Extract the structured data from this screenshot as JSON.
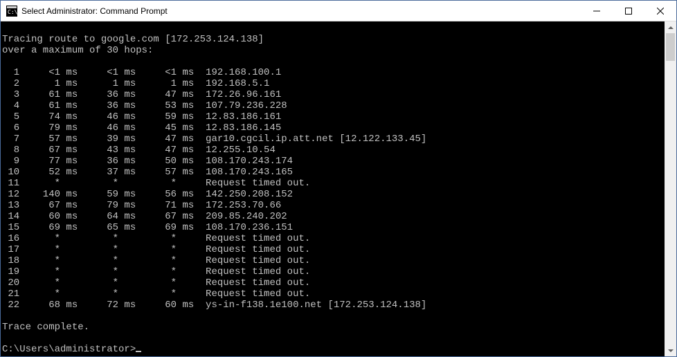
{
  "titlebar": {
    "title": "Select Administrator: Command Prompt"
  },
  "console": {
    "header1": "Tracing route to google.com [172.253.124.138]",
    "header2": "over a maximum of 30 hops:",
    "hops": [
      {
        "n": "1",
        "t1": "<1 ms",
        "t2": "<1 ms",
        "t3": "<1 ms",
        "host": "192.168.100.1"
      },
      {
        "n": "2",
        "t1": "1 ms",
        "t2": "1 ms",
        "t3": "1 ms",
        "host": "192.168.5.1"
      },
      {
        "n": "3",
        "t1": "61 ms",
        "t2": "36 ms",
        "t3": "47 ms",
        "host": "172.26.96.161"
      },
      {
        "n": "4",
        "t1": "61 ms",
        "t2": "36 ms",
        "t3": "53 ms",
        "host": "107.79.236.228"
      },
      {
        "n": "5",
        "t1": "74 ms",
        "t2": "46 ms",
        "t3": "59 ms",
        "host": "12.83.186.161"
      },
      {
        "n": "6",
        "t1": "79 ms",
        "t2": "46 ms",
        "t3": "45 ms",
        "host": "12.83.186.145"
      },
      {
        "n": "7",
        "t1": "57 ms",
        "t2": "39 ms",
        "t3": "47 ms",
        "host": "gar10.cgcil.ip.att.net [12.122.133.45]"
      },
      {
        "n": "8",
        "t1": "67 ms",
        "t2": "43 ms",
        "t3": "47 ms",
        "host": "12.255.10.54"
      },
      {
        "n": "9",
        "t1": "77 ms",
        "t2": "36 ms",
        "t3": "50 ms",
        "host": "108.170.243.174"
      },
      {
        "n": "10",
        "t1": "52 ms",
        "t2": "37 ms",
        "t3": "57 ms",
        "host": "108.170.243.165"
      },
      {
        "n": "11",
        "t1": "*",
        "t2": "*",
        "t3": "*",
        "host": "Request timed out."
      },
      {
        "n": "12",
        "t1": "140 ms",
        "t2": "59 ms",
        "t3": "56 ms",
        "host": "142.250.208.152"
      },
      {
        "n": "13",
        "t1": "67 ms",
        "t2": "79 ms",
        "t3": "71 ms",
        "host": "172.253.70.66"
      },
      {
        "n": "14",
        "t1": "60 ms",
        "t2": "64 ms",
        "t3": "67 ms",
        "host": "209.85.240.202"
      },
      {
        "n": "15",
        "t1": "69 ms",
        "t2": "65 ms",
        "t3": "69 ms",
        "host": "108.170.236.151"
      },
      {
        "n": "16",
        "t1": "*",
        "t2": "*",
        "t3": "*",
        "host": "Request timed out."
      },
      {
        "n": "17",
        "t1": "*",
        "t2": "*",
        "t3": "*",
        "host": "Request timed out."
      },
      {
        "n": "18",
        "t1": "*",
        "t2": "*",
        "t3": "*",
        "host": "Request timed out."
      },
      {
        "n": "19",
        "t1": "*",
        "t2": "*",
        "t3": "*",
        "host": "Request timed out."
      },
      {
        "n": "20",
        "t1": "*",
        "t2": "*",
        "t3": "*",
        "host": "Request timed out."
      },
      {
        "n": "21",
        "t1": "*",
        "t2": "*",
        "t3": "*",
        "host": "Request timed out."
      },
      {
        "n": "22",
        "t1": "68 ms",
        "t2": "72 ms",
        "t3": "60 ms",
        "host": "ys-in-f138.1e100.net [172.253.124.138]"
      }
    ],
    "complete": "Trace complete.",
    "prompt": "C:\\Users\\administrator>"
  }
}
